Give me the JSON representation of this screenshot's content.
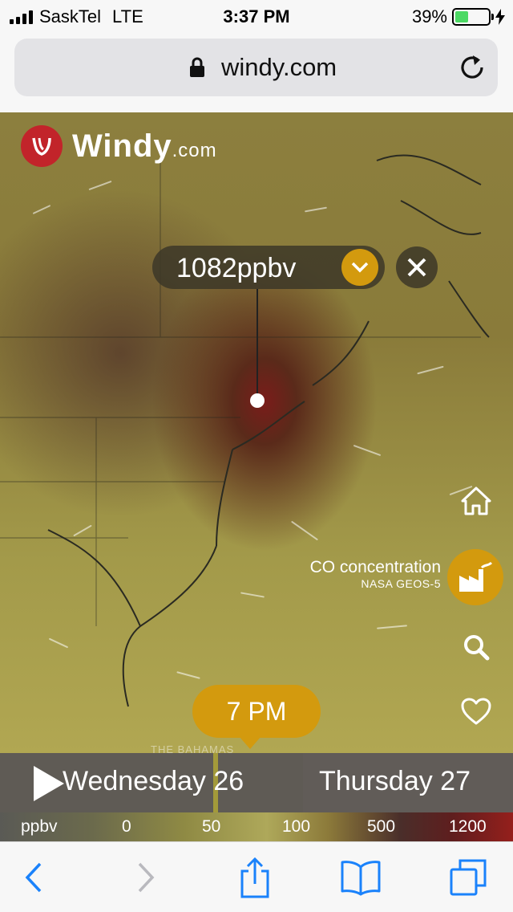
{
  "status_bar": {
    "carrier": "SaskTel",
    "network": "LTE",
    "time": "3:37 PM",
    "battery_percent": "39%",
    "battery_level": 0.39
  },
  "browser": {
    "url": "windy.com"
  },
  "map": {
    "brand": "Windy",
    "brand_suffix": ".com",
    "picker_value": "1082ppbv",
    "layer_name": "CO concentration",
    "layer_source": "NASA GEOS-5",
    "place_label": "THE BAHAMAS"
  },
  "timeline": {
    "current_time": "7 PM",
    "day1": "Wednesday 26",
    "day2": "Thursday 27",
    "progress": 0.42
  },
  "legend": {
    "unit": "ppbv",
    "ticks": [
      "0",
      "50",
      "100",
      "500",
      "1200"
    ]
  },
  "colors": {
    "accent": "#d39a0e",
    "brand_red": "#c2242a",
    "ios_blue": "#1a82fb"
  }
}
